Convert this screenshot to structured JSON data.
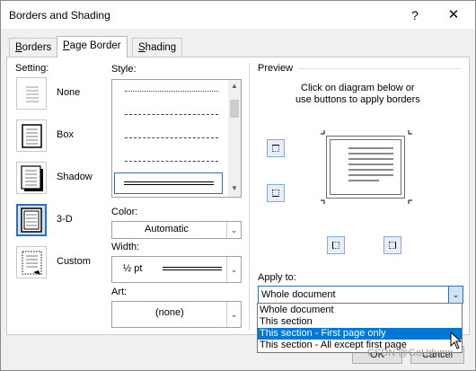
{
  "window": {
    "title": "Borders and Shading",
    "help_glyph": "?",
    "close_glyph": "✕"
  },
  "tabs": [
    {
      "label": "Borders",
      "accel": "B",
      "rest": "orders",
      "active": false
    },
    {
      "label": "Page Border",
      "accel": "P",
      "rest": "age Border",
      "active": true
    },
    {
      "label": "Shading",
      "accel": "S",
      "rest": "hading",
      "active": false
    }
  ],
  "setting": {
    "heading": "Setting:",
    "items": [
      {
        "label": "None",
        "icon": "setting-none-icon"
      },
      {
        "label": "Box",
        "icon": "setting-box-icon"
      },
      {
        "label": "Shadow",
        "icon": "setting-shadow-icon"
      },
      {
        "label": "3-D",
        "icon": "setting-3d-icon",
        "selected": true
      },
      {
        "label": "Custom",
        "icon": "setting-custom-icon"
      }
    ]
  },
  "style": {
    "heading": "Style:",
    "selected": "double line"
  },
  "color": {
    "heading": "Color:",
    "value": "Automatic"
  },
  "width": {
    "heading": "Width:",
    "value": "½ pt"
  },
  "art": {
    "heading": "Art:",
    "value": "(none)"
  },
  "preview": {
    "heading": "Preview",
    "instruction_line1": "Click on diagram below or",
    "instruction_line2": "use buttons to apply borders"
  },
  "apply_to": {
    "heading": "Apply to:",
    "value": "Whole document",
    "options": [
      {
        "label": "Whole document",
        "highlighted": false
      },
      {
        "label": "This section",
        "highlighted": false
      },
      {
        "label": "This section - First page only",
        "highlighted": true
      },
      {
        "label": "This section - All except first page",
        "highlighted": false
      }
    ]
  },
  "buttons": {
    "ok": "OK",
    "cancel": "Cancel"
  },
  "watermark": "CSDN @GoUdump",
  "colors": {
    "accent": "#0078d7",
    "selection_border": "#2f6fbf",
    "selection_fill": "#cfe3f7"
  }
}
